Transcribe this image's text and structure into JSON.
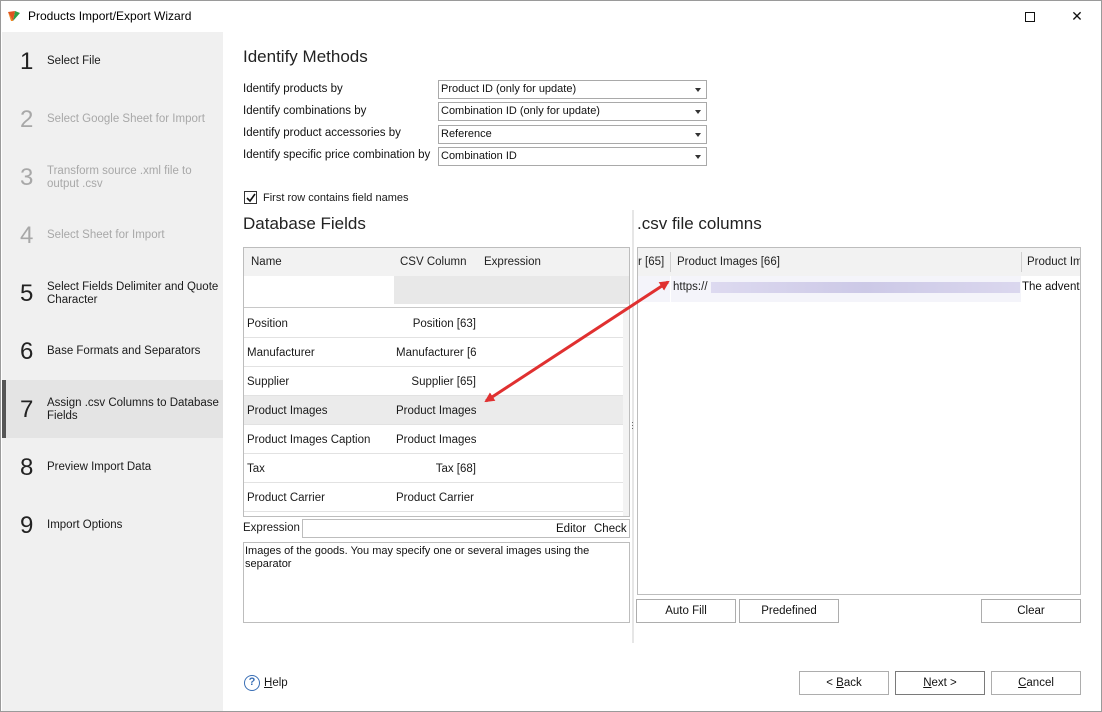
{
  "window": {
    "title": "Products Import/Export Wizard",
    "maximize_icon": "maximize-icon",
    "close_icon": "close-icon",
    "close_glyph": "✕"
  },
  "sidebar": {
    "steps": [
      {
        "num": "1",
        "label": "Select File",
        "state": "enabled"
      },
      {
        "num": "2",
        "label": "Select Google Sheet for Import",
        "state": "disabled"
      },
      {
        "num": "3",
        "label": "Transform source .xml file to output .csv",
        "state": "disabled"
      },
      {
        "num": "4",
        "label": "Select Sheet for Import",
        "state": "disabled"
      },
      {
        "num": "5",
        "label": "Select Fields Delimiter and Quote Character",
        "state": "enabled"
      },
      {
        "num": "6",
        "label": "Base Formats and Separators",
        "state": "enabled"
      },
      {
        "num": "7",
        "label": "Assign .csv Columns to Database Fields",
        "state": "active"
      },
      {
        "num": "8",
        "label": "Preview Import Data",
        "state": "enabled"
      },
      {
        "num": "9",
        "label": "Import Options",
        "state": "enabled"
      }
    ]
  },
  "identify": {
    "title": "Identify Methods",
    "rows": [
      {
        "label": "Identify products by",
        "value": "Product ID (only for update)"
      },
      {
        "label": "Identify combinations by",
        "value": "Combination ID (only for update)"
      },
      {
        "label": "Identify product accessories by",
        "value": "Reference"
      },
      {
        "label": "Identify specific price combination by",
        "value": "Combination ID"
      }
    ],
    "first_row_checkbox": {
      "label": "First row contains field names",
      "checked": true
    }
  },
  "database_fields": {
    "title": "Database Fields",
    "columns": [
      "Name",
      "CSV Column",
      "Expression"
    ],
    "rows": [
      {
        "name": "Position",
        "csv": "Position [63]",
        "align": "right"
      },
      {
        "name": "Manufacturer",
        "csv": "Manufacturer [6",
        "align": "left"
      },
      {
        "name": "Supplier",
        "csv": "Supplier [65]",
        "align": "right"
      },
      {
        "name": "Product Images",
        "csv": "Product Images",
        "align": "left",
        "selected": true
      },
      {
        "name": "Product Images Caption",
        "csv": "Product Images",
        "align": "left"
      },
      {
        "name": "Tax",
        "csv": "Tax [68]",
        "align": "right"
      },
      {
        "name": "Product Carrier",
        "csv": "Product Carrier",
        "align": "left"
      }
    ],
    "expression_label": "Expression",
    "editor_link": "Editor",
    "check_link": "Check",
    "description": "Images of the goods. You may specify one or several images using the separator"
  },
  "csv_columns": {
    "title": ".csv file columns",
    "headers": [
      "r [65]",
      "Product Images [66]",
      "Product Im"
    ],
    "row": {
      "url": "https://",
      "next": "The advent"
    },
    "buttons": {
      "auto_fill": "Auto Fill",
      "predefined": "Predefined",
      "clear": "Clear"
    }
  },
  "footer": {
    "help": "Help",
    "help_glyph": "?",
    "back": "< Back",
    "next": "Next >",
    "cancel": "Cancel"
  },
  "colors": {
    "annotation_arrow": "#e03030",
    "sidebar_bg": "#f0f0f0",
    "active_step_bg": "#e4e4e4"
  }
}
